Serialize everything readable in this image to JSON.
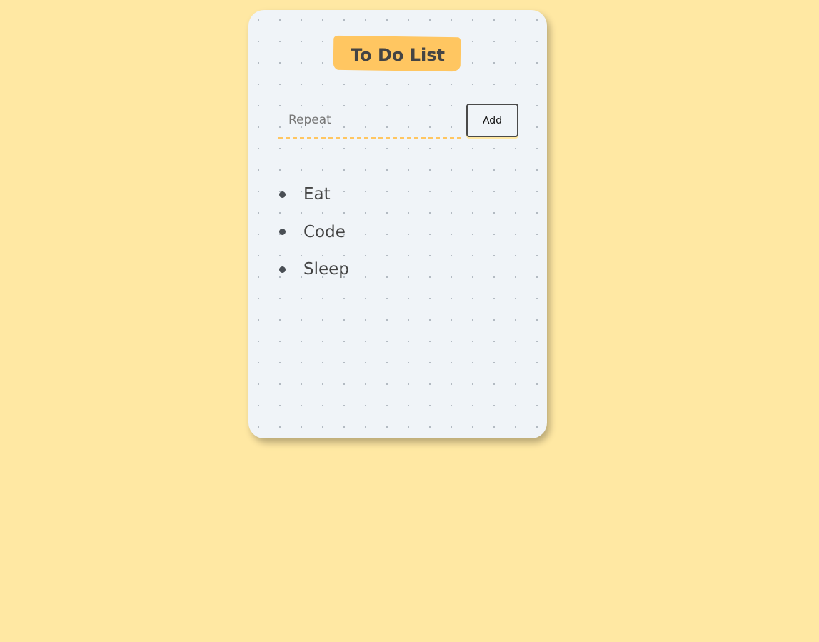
{
  "app": {
    "title": "To Do List"
  },
  "form": {
    "input_placeholder": "Repeat",
    "input_value": "",
    "add_label": "Add"
  },
  "todos": [
    {
      "label": "Eat"
    },
    {
      "label": "Code"
    },
    {
      "label": "Sleep"
    }
  ],
  "colors": {
    "page_background": "#ffe8a3",
    "card_background": "#f0f4f8",
    "accent": "#ffc661",
    "text": "#444444"
  }
}
